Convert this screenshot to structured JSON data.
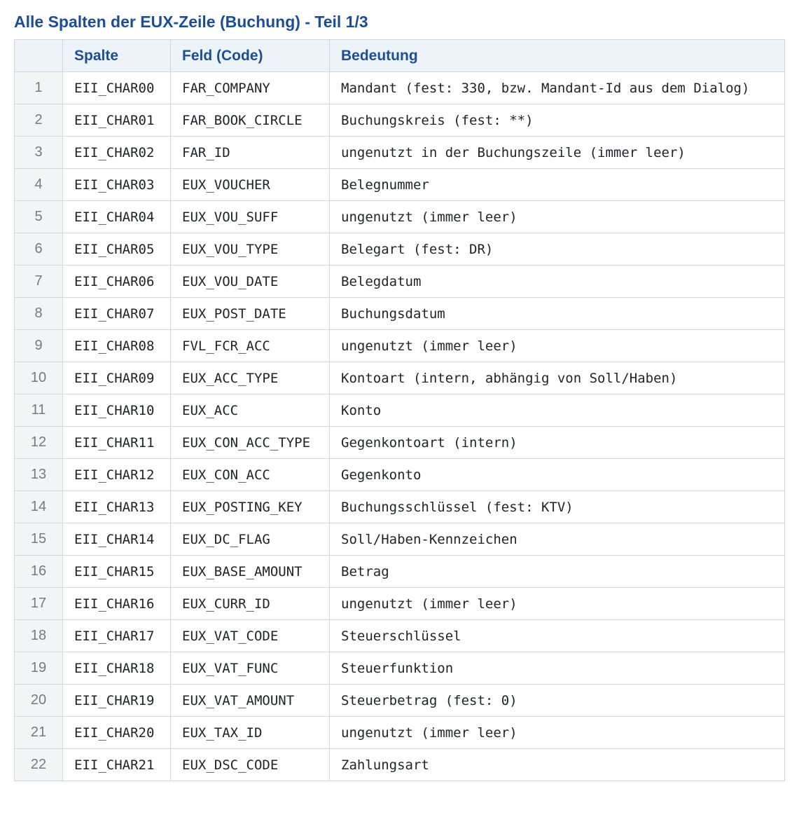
{
  "title": "Alle Spalten der EUX-Zeile (Buchung) - Teil 1/3",
  "table": {
    "headers": [
      "",
      "Spalte",
      "Feld (Code)",
      "Bedeutung"
    ],
    "rows": [
      {
        "index": "1",
        "spalte": "EII_CHAR00",
        "feld": "FAR_COMPANY",
        "bedeutung": "Mandant (fest: 330, bzw. Mandant-Id aus dem Dialog)"
      },
      {
        "index": "2",
        "spalte": "EII_CHAR01",
        "feld": "FAR_BOOK_CIRCLE",
        "bedeutung": "Buchungskreis (fest: **)"
      },
      {
        "index": "3",
        "spalte": "EII_CHAR02",
        "feld": "FAR_ID",
        "bedeutung": "ungenutzt in der Buchungszeile (immer leer)"
      },
      {
        "index": "4",
        "spalte": "EII_CHAR03",
        "feld": "EUX_VOUCHER",
        "bedeutung": "Belegnummer"
      },
      {
        "index": "5",
        "spalte": "EII_CHAR04",
        "feld": "EUX_VOU_SUFF",
        "bedeutung": "ungenutzt (immer leer)"
      },
      {
        "index": "6",
        "spalte": "EII_CHAR05",
        "feld": "EUX_VOU_TYPE",
        "bedeutung": "Belegart (fest: DR)"
      },
      {
        "index": "7",
        "spalte": "EII_CHAR06",
        "feld": "EUX_VOU_DATE",
        "bedeutung": "Belegdatum"
      },
      {
        "index": "8",
        "spalte": "EII_CHAR07",
        "feld": "EUX_POST_DATE",
        "bedeutung": "Buchungsdatum"
      },
      {
        "index": "9",
        "spalte": "EII_CHAR08",
        "feld": "FVL_FCR_ACC",
        "bedeutung": "ungenutzt (immer leer)"
      },
      {
        "index": "10",
        "spalte": "EII_CHAR09",
        "feld": "EUX_ACC_TYPE",
        "bedeutung": "Kontoart (intern, abhängig von Soll/Haben)"
      },
      {
        "index": "11",
        "spalte": "EII_CHAR10",
        "feld": "EUX_ACC",
        "bedeutung": "Konto"
      },
      {
        "index": "12",
        "spalte": "EII_CHAR11",
        "feld": "EUX_CON_ACC_TYPE",
        "bedeutung": "Gegenkontoart (intern)"
      },
      {
        "index": "13",
        "spalte": "EII_CHAR12",
        "feld": "EUX_CON_ACC",
        "bedeutung": "Gegenkonto"
      },
      {
        "index": "14",
        "spalte": "EII_CHAR13",
        "feld": "EUX_POSTING_KEY",
        "bedeutung": "Buchungsschlüssel (fest: KTV)"
      },
      {
        "index": "15",
        "spalte": "EII_CHAR14",
        "feld": "EUX_DC_FLAG",
        "bedeutung": "Soll/Haben-Kennzeichen"
      },
      {
        "index": "16",
        "spalte": "EII_CHAR15",
        "feld": "EUX_BASE_AMOUNT",
        "bedeutung": "Betrag"
      },
      {
        "index": "17",
        "spalte": "EII_CHAR16",
        "feld": "EUX_CURR_ID",
        "bedeutung": "ungenutzt (immer leer)"
      },
      {
        "index": "18",
        "spalte": "EII_CHAR17",
        "feld": "EUX_VAT_CODE",
        "bedeutung": "Steuerschlüssel"
      },
      {
        "index": "19",
        "spalte": "EII_CHAR18",
        "feld": "EUX_VAT_FUNC",
        "bedeutung": "Steuerfunktion"
      },
      {
        "index": "20",
        "spalte": "EII_CHAR19",
        "feld": "EUX_VAT_AMOUNT",
        "bedeutung": "Steuerbetrag (fest: 0)"
      },
      {
        "index": "21",
        "spalte": "EII_CHAR20",
        "feld": "EUX_TAX_ID",
        "bedeutung": "ungenutzt (immer leer)"
      },
      {
        "index": "22",
        "spalte": "EII_CHAR21",
        "feld": "EUX_DSC_CODE",
        "bedeutung": "Zahlungsart"
      }
    ]
  },
  "colors": {
    "title": "#1c4e96",
    "header_bg": "#eef3fa",
    "index_bg": "#f3f4f6",
    "border": "#d2d6db"
  }
}
